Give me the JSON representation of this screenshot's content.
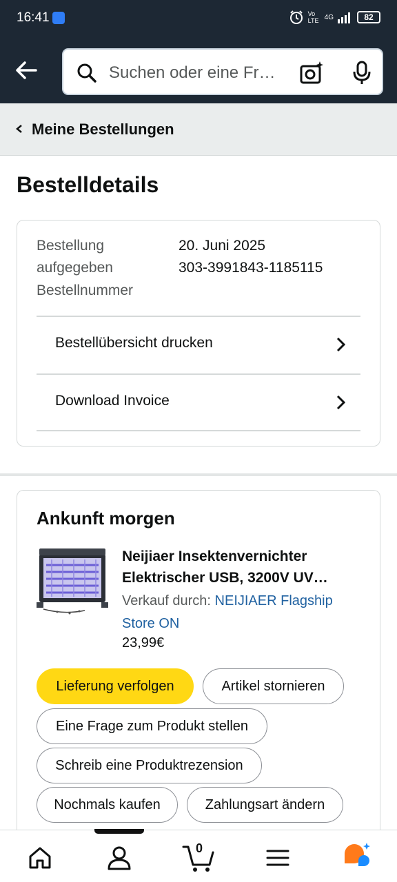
{
  "status_bar": {
    "time": "16:41",
    "network": "4G",
    "volte": "Vo LTE",
    "battery": "82"
  },
  "header": {
    "search_placeholder": "Suchen oder eine Fr…"
  },
  "breadcrumb": {
    "label": "Meine Bestellungen"
  },
  "page": {
    "title": "Bestelldetails"
  },
  "order_summary": {
    "placed_label_line1": "Bestellung",
    "placed_label_line2": "aufgegeben",
    "number_label": "Bestellnummer",
    "placed_date": "20. Juni 2025",
    "order_number": "303-3991843-1185115",
    "links": [
      {
        "label": "Bestellübersicht drucken"
      },
      {
        "label": "Download Invoice"
      }
    ]
  },
  "shipment": {
    "heading": "Ankunft morgen",
    "product": {
      "title_line1": "Neijiaer Insektenvernichter",
      "title_line2": "Elektrischer USB, 3200V UV…",
      "sold_by_label": "Verkauf durch: ",
      "seller_line1": "NEIJIAER Flagship",
      "seller_line2": "Store ON",
      "price": "23,99€"
    },
    "actions": {
      "track": "Lieferung verfolgen",
      "cancel": "Artikel stornieren",
      "question": "Eine Frage zum Produkt stellen",
      "review": "Schreib eine Produktrezension",
      "buy_again": "Nochmals kaufen",
      "change_payment": "Zahlungsart ändern"
    }
  },
  "bottom_nav": {
    "cart_count": "0"
  },
  "colors": {
    "header_bg": "#1d2834",
    "primary_button": "#ffd814",
    "link": "#2162a1",
    "assistant_orange": "#ff7a1a",
    "assistant_blue": "#1a8cff"
  },
  "icons": [
    "back-arrow-icon",
    "search-icon",
    "camera-sparkle-icon",
    "microphone-icon",
    "chevron-left-icon",
    "chevron-right-icon",
    "home-icon",
    "account-icon",
    "cart-icon",
    "menu-icon",
    "assistant-icon"
  ]
}
